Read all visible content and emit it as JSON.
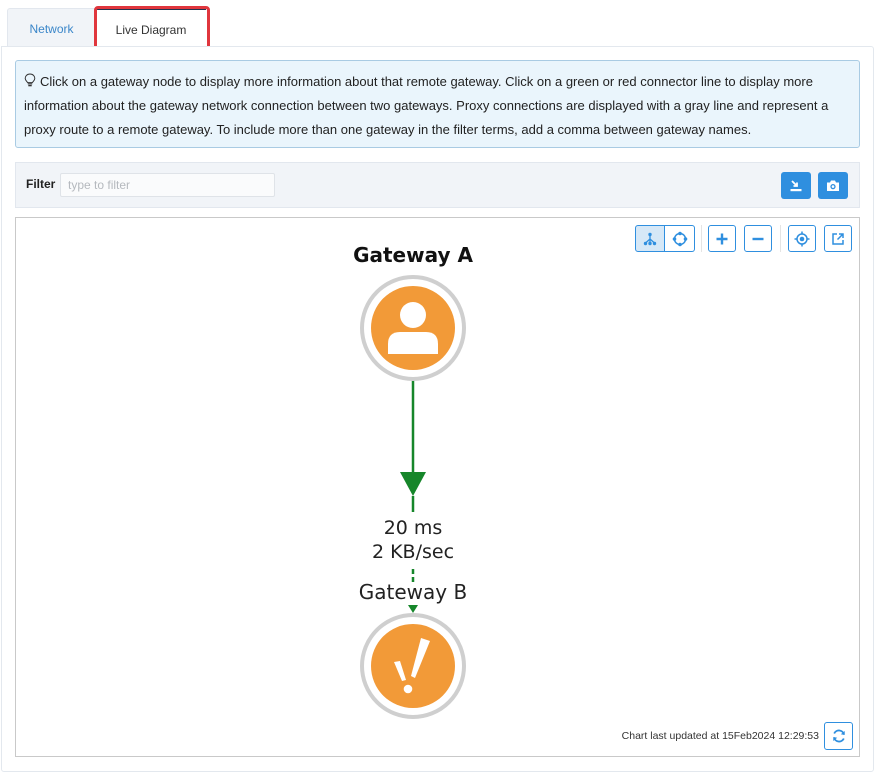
{
  "tabs": [
    {
      "label": "Network",
      "active": false
    },
    {
      "label": "Live Diagram",
      "active": true
    }
  ],
  "info": {
    "icon": "lightbulb-icon",
    "text": "Click on a gateway node to display more information about that remote gateway. Click on a green or red connector line to display more information about the gateway network connection between two gateways. Proxy connections are displayed with a gray line and represent a proxy route to a remote gateway. To include more than one gateway in the filter terms, add a comma between gateway names."
  },
  "filter": {
    "label": "Filter",
    "value": "",
    "placeholder": "type to filter",
    "buttons": [
      {
        "name": "export-button",
        "icon": "download-icon"
      },
      {
        "name": "screenshot-button",
        "icon": "camera-icon"
      }
    ]
  },
  "toolbar": {
    "buttons": [
      {
        "name": "hierarchical-layout-button",
        "icon": "hierarchy-icon",
        "selected": true
      },
      {
        "name": "radial-layout-button",
        "icon": "radial-layout-icon",
        "selected": false
      },
      {
        "name": "zoom-in-button",
        "icon": "plus-icon"
      },
      {
        "name": "zoom-out-button",
        "icon": "minus-icon"
      },
      {
        "name": "center-button",
        "icon": "target-icon"
      },
      {
        "name": "popout-button",
        "icon": "external-link-icon"
      }
    ]
  },
  "diagram": {
    "nodes": [
      {
        "id": "a",
        "label": "Gateway A",
        "icon": "user-icon",
        "status": "local",
        "fill": "#f29a38"
      },
      {
        "id": "b",
        "label": "Gateway B",
        "icon": "warning-icon",
        "status": "warning",
        "fill": "#f29a38"
      }
    ],
    "edges": [
      {
        "from": "a",
        "to": "b",
        "latency": "20 ms",
        "throughput": "2 KB/sec",
        "color": "#16862a"
      }
    ]
  },
  "footer": {
    "updated_text": "Chart last updated at 15Feb2024 12:29:53",
    "refresh_icon": "refresh-icon"
  }
}
